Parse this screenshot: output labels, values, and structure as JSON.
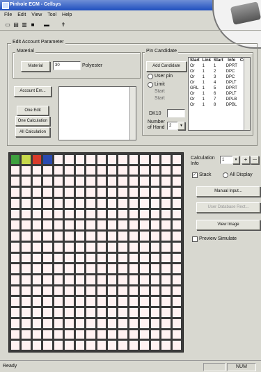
{
  "window": {
    "title": "Pinhole ECM - Cellsys"
  },
  "menu": [
    "File",
    "Edit",
    "View",
    "Tool",
    "Help"
  ],
  "toolbar_icons": [
    "new-icon",
    "open-icon",
    "folder-icon",
    "save-icon",
    "print-icon",
    "pin-icon"
  ],
  "main_group": {
    "title": "Edit Account Parameter"
  },
  "material": {
    "title": "Material",
    "button": "Material",
    "value": "30",
    "unit": "Polyester"
  },
  "pin_candidate": {
    "title": "Pin Candidate",
    "button": "Add Candidate",
    "user_pin_label": "User pin",
    "limit_label": "Limit",
    "limit_hint": "Start",
    "limit_hint2": "Start",
    "dark_label": "DK10",
    "dark_value": "",
    "number_label": "Number",
    "number_label2": "of Hand",
    "number_value": "2"
  },
  "address_table": {
    "headers": [
      "Start",
      "Link",
      "Start",
      "Info",
      "Code"
    ],
    "rows": [
      [
        "Or",
        "1",
        "1",
        "DPRT",
        ""
      ],
      [
        "Or",
        "1",
        "2",
        "DPC",
        ""
      ],
      [
        "Or",
        "1",
        "3",
        "DPC",
        ""
      ],
      [
        "Or",
        "1",
        "4",
        "DPLT",
        ""
      ],
      [
        "GRL",
        "1",
        "5",
        "DPRT",
        ""
      ],
      [
        "Or",
        "1",
        "6",
        "DPLT",
        ""
      ],
      [
        "Or",
        "1",
        "7",
        "DPLB",
        ""
      ],
      [
        "Or",
        "1",
        "8",
        "DPBL",
        ""
      ]
    ]
  },
  "account": {
    "account_button": "Account Em...",
    "one_edit": "One Edit",
    "one_calculation": "One Calculation",
    "all_calculation": "All Calculation"
  },
  "right_panel": {
    "calculation_label": "Calculation",
    "calculation_label2": "Info",
    "calculation_value": "1",
    "plus": "+",
    "minus": "—",
    "stack": "Stack",
    "all_display": "All Display",
    "manual_input": "Manual Input...",
    "user_database": "User Database Rect...",
    "view_image": "View Image",
    "preview_simulate": "Preview Simulate"
  },
  "grid": {
    "rows": 18,
    "cols": 16,
    "accent_colors": [
      "#3ea03e",
      "#c8d84a",
      "#d83a2a",
      "#2a4ab0"
    ]
  },
  "status": {
    "left": "Ready",
    "right": "NUM"
  }
}
